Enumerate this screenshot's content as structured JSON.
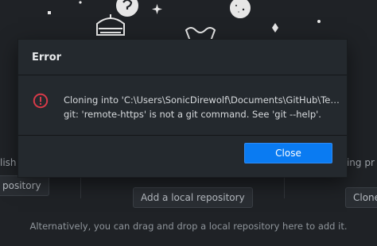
{
  "background": {
    "left_panel_label": "lish",
    "left_panel_button": "pository",
    "center_button": "Add a local repository",
    "right_panel_label": "sting pr",
    "right_panel_button": "Clone",
    "hint": "Alternatively, you can drag and drop a local repository here to add it."
  },
  "dialog": {
    "title": "Error",
    "icon": "error-circle-icon",
    "message_line1": "Cloning into 'C:\\Users\\SonicDirewolf\\Documents\\GitHub\\TestPUBLIC'...",
    "message_line2": "git: 'remote-https' is not a git command. See 'git --help'.",
    "close_label": "Close"
  },
  "colors": {
    "accent": "#0a7bf2",
    "error": "#d73a49",
    "dialog_bg": "#24292e",
    "app_bg": "#1f2226"
  }
}
